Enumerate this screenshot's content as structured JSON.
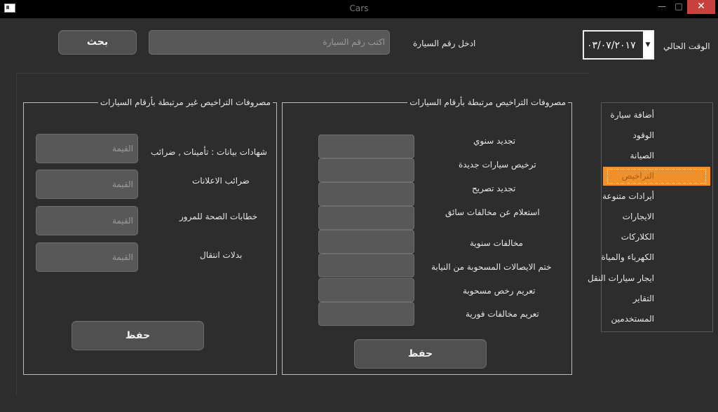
{
  "window": {
    "title": "Cars",
    "min": "—",
    "max": "□",
    "close": "✕"
  },
  "header": {
    "current_time_label": "الوقت الحالي",
    "date_value": "٠٣/٠٧/٢٠١٧",
    "car_number_label": "ادخل رقم السيارة",
    "car_number_placeholder": "اكتب رقم السيارة",
    "search_button": "بحث"
  },
  "linked_group": {
    "title": "مصروفات التراخيص مرتبطة بأرقام السيارات",
    "rows": [
      "تجديد سنوي",
      "ترخيص سيارات جديدة",
      "تجديد تصريح",
      "استعلام عن مخالفات سائق",
      "مخالفات سنوية",
      "ختم الايصالات المسحوبة من النيابة",
      "تعريم رخص مسحوبة",
      "تعريم مخالفات فورية"
    ],
    "save_button": "حفظ"
  },
  "unlinked_group": {
    "title": "مصروفات التراخيص غير مرتبطة بأرقام السيارات",
    "rows": [
      {
        "label": "شهادات بيانات : تأمينات , ضرائب",
        "placeholder": "القيمة"
      },
      {
        "label": "ضرائب الاعلانات",
        "placeholder": "القيمة"
      },
      {
        "label": "خطابات الصحة للمرور",
        "placeholder": "القيمة"
      },
      {
        "label": "بدلات انتقال",
        "placeholder": "القيمة"
      }
    ],
    "save_button": "حفظ"
  },
  "sidebar": {
    "items": [
      {
        "label": "أضافة سيارة"
      },
      {
        "label": "الوقود"
      },
      {
        "label": "الصيانة"
      },
      {
        "label": "التراخيص"
      },
      {
        "label": "أيرادات متنوعة"
      },
      {
        "label": "الايجارات"
      },
      {
        "label": "الكلاركات"
      },
      {
        "label": "الكهرباء والمياة"
      },
      {
        "label": "ايجار سيارات النقل"
      },
      {
        "label": "التقاير"
      },
      {
        "label": "المستخدمين"
      }
    ],
    "active_index": 3,
    "active_color": "#f0912c"
  }
}
